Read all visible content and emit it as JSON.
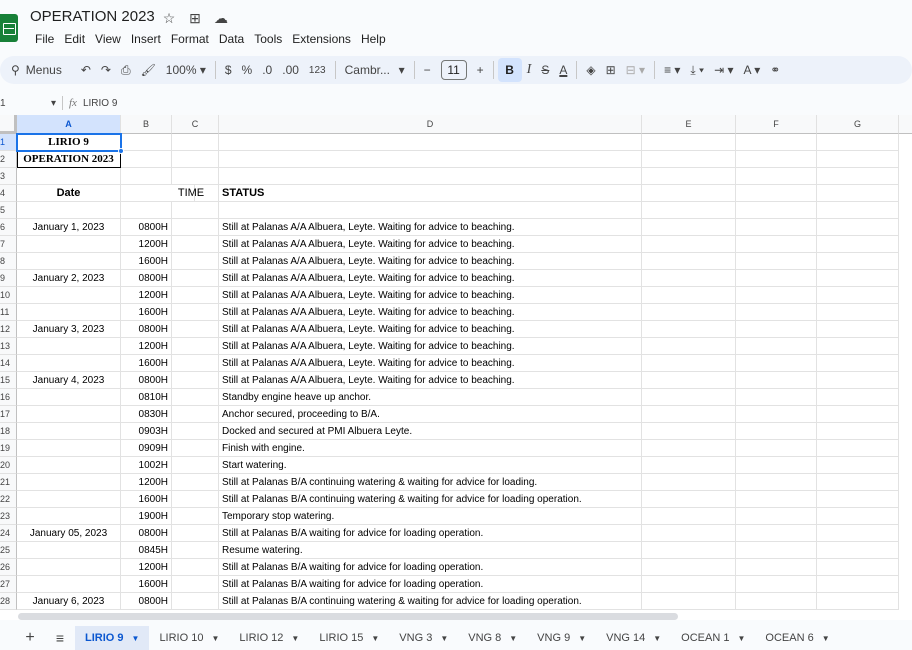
{
  "doc": {
    "title": "OPERATION 2023"
  },
  "menu": [
    "File",
    "Edit",
    "View",
    "Insert",
    "Format",
    "Data",
    "Tools",
    "Extensions",
    "Help"
  ],
  "toolbar": {
    "menus_label": "Menus",
    "zoom": "100%",
    "currency": "$",
    "percent": "%",
    "dec_decrease": ".0",
    "dec_increase": ".00",
    "number_format": "123",
    "font": "Cambr...",
    "font_size": "11",
    "minus": "−",
    "plus": "+",
    "bold": "B",
    "italic": "I",
    "strike": "S",
    "text_color": "A"
  },
  "formula_bar": {
    "cell_ref": "1",
    "content": "LIRIO 9"
  },
  "columns": [
    "A",
    "B",
    "C",
    "D",
    "E",
    "F",
    "G"
  ],
  "rows": [
    {
      "n": "1",
      "a": "LIRIO 9",
      "b": "",
      "d": ""
    },
    {
      "n": "2",
      "a": "OPERATION 2023",
      "b": "",
      "d": ""
    },
    {
      "n": "3",
      "a": "",
      "b": "",
      "d": ""
    },
    {
      "n": "4",
      "a": "Date",
      "b": "TIME",
      "d": "STATUS"
    },
    {
      "n": "5",
      "a": "",
      "b": "",
      "d": ""
    },
    {
      "n": "6",
      "a": "January 1, 2023",
      "b": "0800H",
      "d": "Still at Palanas A/A Albuera, Leyte. Waiting for advice to beaching."
    },
    {
      "n": "7",
      "a": "",
      "b": "1200H",
      "d": "Still at Palanas A/A Albuera, Leyte. Waiting for advice to beaching."
    },
    {
      "n": "8",
      "a": "",
      "b": "1600H",
      "d": "Still at Palanas A/A Albuera, Leyte. Waiting for advice to beaching."
    },
    {
      "n": "9",
      "a": "January 2, 2023",
      "b": "0800H",
      "d": "Still at Palanas A/A Albuera, Leyte. Waiting for advice to beaching."
    },
    {
      "n": "10",
      "a": "",
      "b": "1200H",
      "d": "Still at Palanas A/A Albuera, Leyte. Waiting for advice to beaching."
    },
    {
      "n": "11",
      "a": "",
      "b": "1600H",
      "d": "Still at Palanas A/A Albuera, Leyte. Waiting for advice to beaching."
    },
    {
      "n": "12",
      "a": "January 3, 2023",
      "b": "0800H",
      "d": "Still at Palanas A/A Albuera, Leyte. Waiting for advice to beaching."
    },
    {
      "n": "13",
      "a": "",
      "b": "1200H",
      "d": "Still at Palanas A/A Albuera, Leyte. Waiting for advice to beaching."
    },
    {
      "n": "14",
      "a": "",
      "b": "1600H",
      "d": "Still at Palanas A/A Albuera, Leyte. Waiting for advice to beaching."
    },
    {
      "n": "15",
      "a": "January 4, 2023",
      "b": "0800H",
      "d": "Still at Palanas A/A Albuera, Leyte. Waiting for advice to beaching."
    },
    {
      "n": "16",
      "a": "",
      "b": "0810H",
      "d": "Standby engine heave up anchor."
    },
    {
      "n": "17",
      "a": "",
      "b": "0830H",
      "d": "Anchor secured, proceeding to B/A."
    },
    {
      "n": "18",
      "a": "",
      "b": "0903H",
      "d": "Docked and secured at PMI Albuera Leyte."
    },
    {
      "n": "19",
      "a": "",
      "b": "0909H",
      "d": "Finish with engine."
    },
    {
      "n": "20",
      "a": "",
      "b": "1002H",
      "d": "Start watering."
    },
    {
      "n": "21",
      "a": "",
      "b": "1200H",
      "d": "Still at Palanas B/A continuing watering & waiting for advice for loading."
    },
    {
      "n": "22",
      "a": "",
      "b": "1600H",
      "d": "Still at Palanas B/A continuing watering & waiting for advice for loading operation."
    },
    {
      "n": "23",
      "a": "",
      "b": "1900H",
      "d": "Temporary stop watering."
    },
    {
      "n": "24",
      "a": "January 05, 2023",
      "b": "0800H",
      "d": "Still at Palanas B/A waiting for advice for loading operation."
    },
    {
      "n": "25",
      "a": "",
      "b": "0845H",
      "d": "Resume watering."
    },
    {
      "n": "26",
      "a": "",
      "b": "1200H",
      "d": "Still at Palanas B/A waiting for advice for loading operation."
    },
    {
      "n": "27",
      "a": "",
      "b": "1600H",
      "d": "Still at Palanas B/A waiting for advice for loading operation."
    },
    {
      "n": "28",
      "a": "January 6, 2023",
      "b": "0800H",
      "d": "Still at Palanas B/A continuing watering & waiting for advice for loading operation."
    }
  ],
  "sheet_tabs": [
    "LIRIO 9",
    "LIRIO 10",
    "LIRIO 12",
    "LIRIO 15",
    "VNG 3",
    "VNG 8",
    "VNG 9",
    "VNG 14",
    "OCEAN 1",
    "OCEAN 6"
  ],
  "active_tab": "LIRIO 9",
  "colors": {
    "accent": "#0b57d0",
    "selection": "#1a73e8",
    "sheets_green": "#188038"
  }
}
